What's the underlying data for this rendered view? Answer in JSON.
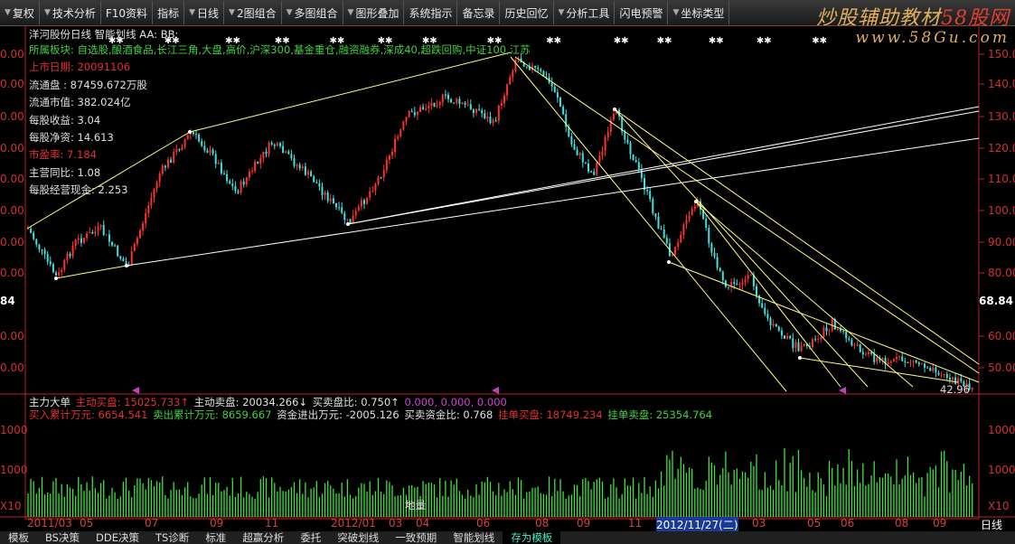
{
  "toolbar": {
    "items": [
      {
        "label": "复权",
        "arrow": true
      },
      {
        "label": "技术分析",
        "arrow": true
      },
      {
        "label": "F10资料",
        "arrow": false
      },
      {
        "label": "指标",
        "arrow": false
      },
      {
        "label": "日线",
        "arrow": true
      },
      {
        "label": "2图组合",
        "arrow": true
      },
      {
        "label": "多图组合",
        "arrow": true
      },
      {
        "label": "图形叠加",
        "arrow": true
      },
      {
        "label": "系统指示",
        "arrow": false
      },
      {
        "label": "备忘录",
        "arrow": false
      },
      {
        "label": "历史回忆",
        "arrow": false
      },
      {
        "label": "分析工具",
        "arrow": true
      },
      {
        "label": "闪电预警",
        "arrow": false
      },
      {
        "label": "坐标类型",
        "arrow": true
      }
    ],
    "brand_line1_a": "炒股辅助教材",
    "brand_line1_b": "58股网",
    "brand_line2": "www.58Gu.com"
  },
  "stock": {
    "title": "洋河股份日线  智能划线 AA: BB:",
    "info": [
      {
        "text": "所属板块: 自选股,酿酒食品,长江三角,大盘,高价,沪深300,基金重仓,融资融券,深成40,超跌回购,中证100,江苏",
        "color": "#40d040"
      },
      {
        "text": "上市日期: 20091106",
        "color": "#e03030"
      },
      {
        "text": "流通盘  : 87459.672万股",
        "color": "#e0e0e0"
      },
      {
        "text": "流通市值: 382.024亿",
        "color": "#e0e0e0"
      },
      {
        "text": "每股收益: 3.04",
        "color": "#e0e0e0"
      },
      {
        "text": "每股净资: 14.613",
        "color": "#e0e0e0"
      },
      {
        "text": "市盈率: 7.184",
        "color": "#e03030"
      },
      {
        "text": "主营同比: 1.08",
        "color": "#e0e0e0"
      },
      {
        "text": "每股经营现金: 2.253",
        "color": "#e0e0e0"
      }
    ],
    "current_price": "68.84",
    "low_label": "42.96"
  },
  "right_axis": [
    "150.0",
    "140.00",
    "130.00",
    "120.00",
    "110.00",
    "100.00",
    "90.00",
    "80.00",
    "60.00",
    "50.00"
  ],
  "left_axis": [
    "0.00",
    "0.00",
    "0.00",
    "0.00",
    "0.00",
    "0.00",
    "0.00",
    "0.00",
    "0.00",
    "0.00"
  ],
  "flow": {
    "row1": [
      {
        "t": "主力大单",
        "c": "#e0e0e0"
      },
      {
        "t": "主动买盘: 15025.733↑",
        "c": "#e03030"
      },
      {
        "t": "主动卖盘: 20034.266↓",
        "c": "#e0e0e0"
      },
      {
        "t": "买卖盘比: 0.750↑",
        "c": "#e0e0e0"
      },
      {
        "t": "0.000, 0.000, 0.000",
        "c": "#d040d0"
      }
    ],
    "row2": [
      {
        "t": "买入累计万元: 6654.541",
        "c": "#e03030"
      },
      {
        "t": "卖出累计万元: 8659.667",
        "c": "#40d040"
      },
      {
        "t": "资金进出万元: -2005.126",
        "c": "#e0e0e0"
      },
      {
        "t": "买卖资金比: 0.768",
        "c": "#e0e0e0"
      },
      {
        "t": "挂单买盘: 18749.234",
        "c": "#e03030"
      },
      {
        "t": "挂单卖盘: 25354.764",
        "c": "#40d040"
      }
    ]
  },
  "vol_axis": [
    "1000",
    "1000",
    "X10"
  ],
  "vol_label": "地量",
  "x_dates": [
    "2011/03",
    "05",
    "07",
    "09",
    "11",
    "2012/01",
    "03",
    "04",
    "06",
    "08",
    "09",
    "11",
    "2012/11/27(二)",
    "03",
    "05",
    "06",
    "08",
    "09"
  ],
  "period_label": "日线",
  "bottom_tabs": [
    {
      "label": "模板",
      "active": false
    },
    {
      "label": "BS决策",
      "active": false
    },
    {
      "label": "DDE决策",
      "active": false
    },
    {
      "label": "TS诊断",
      "active": false
    },
    {
      "label": "标准",
      "active": false
    },
    {
      "label": "超赢分析",
      "active": false
    },
    {
      "label": "委托",
      "active": false
    },
    {
      "label": "突破划线",
      "active": false
    },
    {
      "label": "一致预期",
      "active": false
    },
    {
      "label": "智能划线",
      "active": false
    },
    {
      "label": "存为模板",
      "active": true
    }
  ],
  "colors": {
    "up": "#ff3030",
    "down": "#40e0e0",
    "line": "#ffff80",
    "axis": "#c02020",
    "volume": "#40e040"
  }
}
